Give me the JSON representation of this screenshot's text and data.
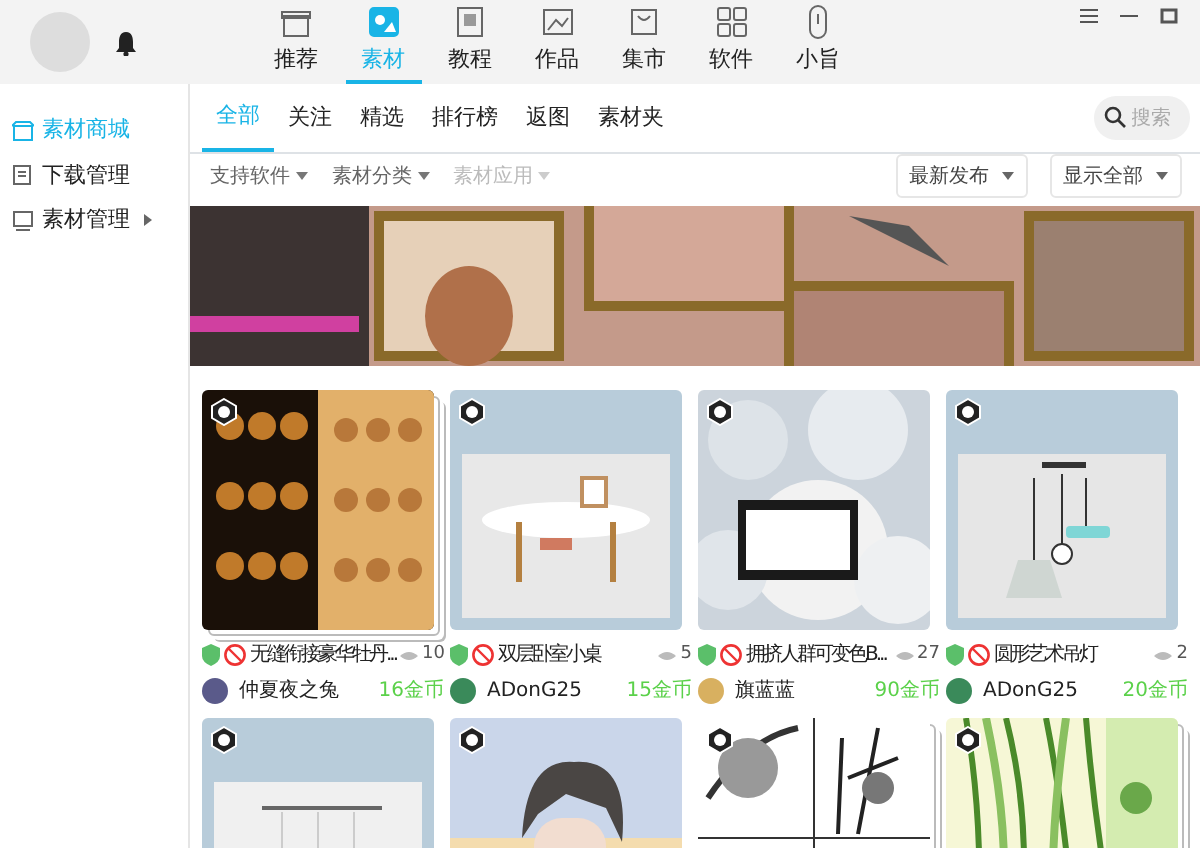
{
  "nav": [
    {
      "label": "推荐",
      "selected": false
    },
    {
      "label": "素材",
      "selected": true
    },
    {
      "label": "教程",
      "selected": false
    },
    {
      "label": "作品",
      "selected": false
    },
    {
      "label": "集市",
      "selected": false
    },
    {
      "label": "软件",
      "selected": false
    },
    {
      "label": "小旨",
      "selected": false
    }
  ],
  "sidebar": {
    "items": [
      {
        "label": "素材商城",
        "selected": true
      },
      {
        "label": "下载管理",
        "selected": false
      },
      {
        "label": "素材管理",
        "selected": false,
        "expanded": false
      }
    ]
  },
  "tabs": [
    {
      "label": "全部",
      "selected": true
    },
    {
      "label": "关注",
      "selected": false
    },
    {
      "label": "精选",
      "selected": false
    },
    {
      "label": "排行榜",
      "selected": false
    },
    {
      "label": "返图",
      "selected": false
    },
    {
      "label": "素材夹",
      "selected": false
    }
  ],
  "search": {
    "placeholder": "搜索"
  },
  "filters": [
    {
      "label": "支持软件",
      "disabled": false
    },
    {
      "label": "素材分类",
      "disabled": false
    },
    {
      "label": "素材应用",
      "disabled": true
    }
  ],
  "dropdowns": [
    {
      "label": "最新发布"
    },
    {
      "label": "显示全部"
    }
  ],
  "cards": [
    {
      "title": "无缝衔接豪华牡丹...",
      "views": "10",
      "author": "仲夏夜之兔",
      "price": "16金币",
      "stacked": true
    },
    {
      "title": "双层卧室小桌",
      "views": "5",
      "author": "ADonG25",
      "price": "15金币",
      "stacked": false
    },
    {
      "title": "拥挤人群可变色B...",
      "views": "27",
      "author": "旗蓝蓝",
      "price": "90金币",
      "stacked": false
    },
    {
      "title": "圆形艺术吊灯",
      "views": "2",
      "author": "ADonG25",
      "price": "20金币",
      "stacked": false
    },
    {
      "stacked": false
    },
    {
      "stacked": false
    },
    {
      "stacked": true
    },
    {
      "stacked": true
    }
  ]
}
